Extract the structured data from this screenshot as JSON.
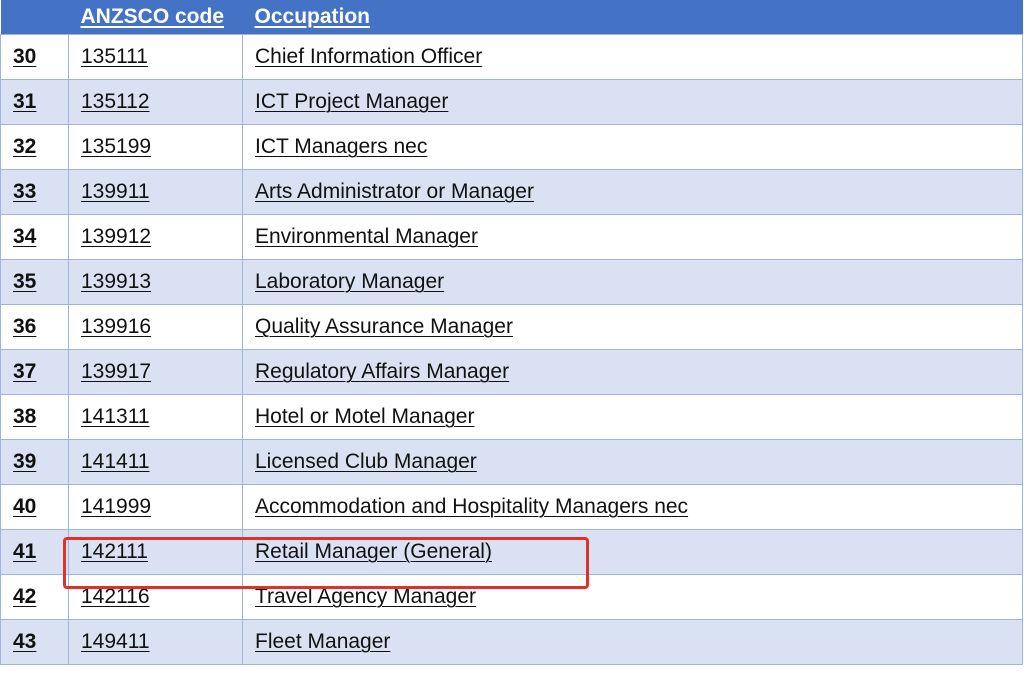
{
  "table": {
    "headers": {
      "num": "",
      "code": "ANZSCO code",
      "occupation": "Occupation"
    },
    "rows": [
      {
        "num": "30",
        "code": "135111",
        "occupation": "Chief Information Officer"
      },
      {
        "num": "31",
        "code": "135112",
        "occupation": "ICT Project Manager"
      },
      {
        "num": "32",
        "code": "135199",
        "occupation": "ICT Managers nec"
      },
      {
        "num": "33",
        "code": "139911",
        "occupation": "Arts Administrator or Manager"
      },
      {
        "num": "34",
        "code": "139912",
        "occupation": "Environmental Manager"
      },
      {
        "num": "35",
        "code": "139913",
        "occupation": "Laboratory Manager"
      },
      {
        "num": "36",
        "code": "139916",
        "occupation": "Quality Assurance Manager"
      },
      {
        "num": "37",
        "code": "139917",
        "occupation": "Regulatory Affairs Manager"
      },
      {
        "num": "38",
        "code": "141311",
        "occupation": "Hotel or Motel Manager"
      },
      {
        "num": "39",
        "code": "141411",
        "occupation": "Licensed Club Manager"
      },
      {
        "num": "40",
        "code": "141999",
        "occupation": "Accommodation and Hospitality Managers nec"
      },
      {
        "num": "41",
        "code": "142111",
        "occupation": "Retail Manager (General)"
      },
      {
        "num": "42",
        "code": "142116",
        "occupation": "Travel Agency Manager"
      },
      {
        "num": "43",
        "code": "149411",
        "occupation": "Fleet Manager"
      }
    ]
  },
  "highlight": {
    "row_num": "41",
    "color": "#e0302a"
  },
  "colors": {
    "header_bg": "#4472c4",
    "header_text": "#ffffff",
    "stripe_bg": "#d9e1f2",
    "border": "#9db4dc"
  }
}
